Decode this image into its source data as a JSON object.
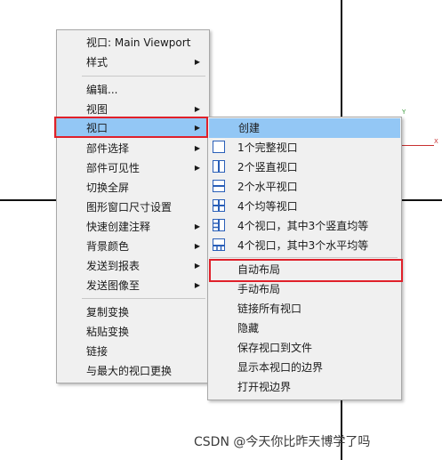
{
  "menu1": {
    "items": [
      "视口: Main Viewport",
      "样式",
      "编辑...",
      "视图",
      "视口",
      "部件选择",
      "部件可见性",
      "切换全屏",
      "图形窗口尺寸设置",
      "快速创建注释",
      "背景颜色",
      "发送到报表",
      "发送图像至",
      "复制变换",
      "粘贴变换",
      "链接",
      "与最大的视口更换"
    ]
  },
  "menu2": {
    "items": [
      "创建",
      "1个完整视口",
      "2个竖直视口",
      "2个水平视口",
      "4个均等视口",
      "4个视口，其中3个竖直均等",
      "4个视口，其中3个水平均等",
      "自动布局",
      "手动布局",
      "链接所有视口",
      "隐藏",
      "保存视口到文件",
      "显示本视口的边界",
      "打开视边界"
    ]
  },
  "axes": {
    "y": "Y",
    "x": "X"
  },
  "watermark": "CSDN @今天你比昨天博学了吗",
  "colors": {
    "highlight": "#93c7f5",
    "annotation_red": "#e0202a",
    "icon_blue": "#2a5fb8"
  }
}
